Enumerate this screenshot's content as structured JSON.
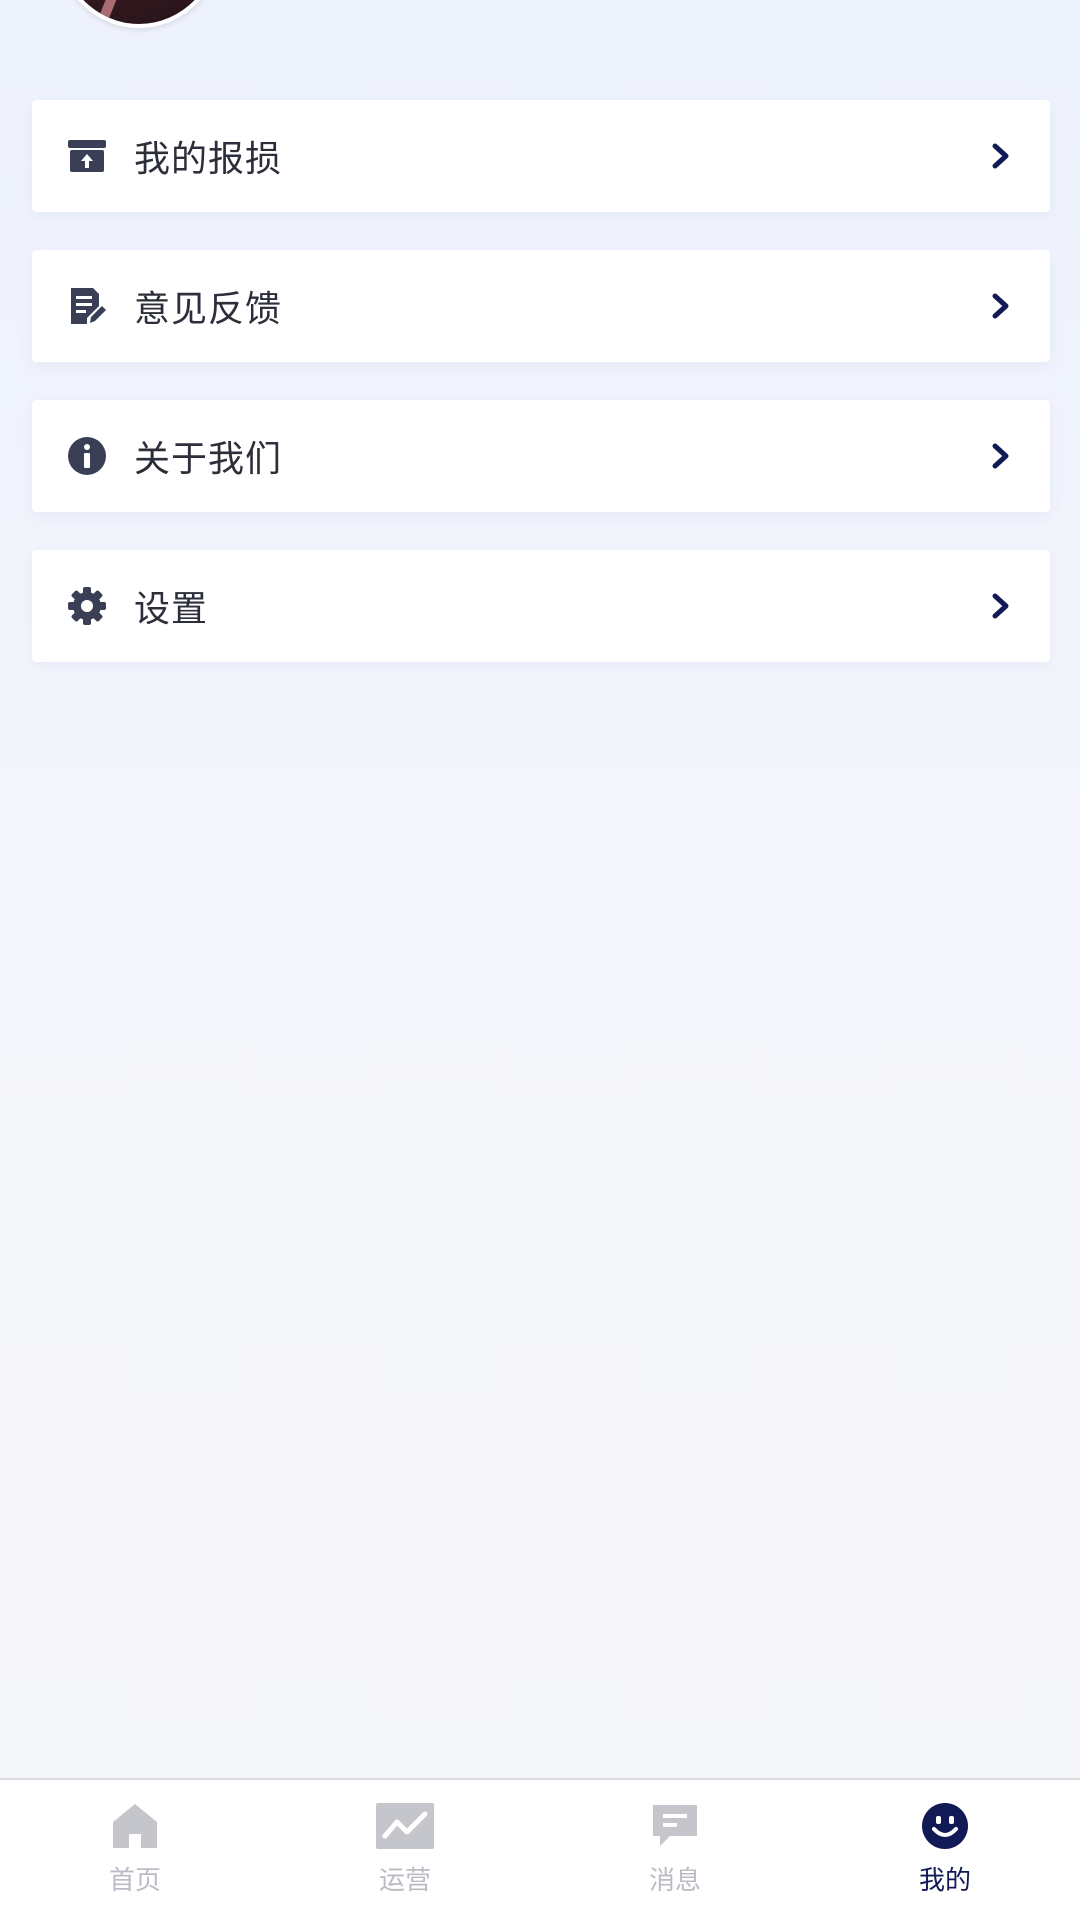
{
  "colors": {
    "accent": "#121a56",
    "icon_dark": "#3b3f55",
    "tab_inactive": "#c4c6cc"
  },
  "menu": {
    "items": [
      {
        "label": "我的报损",
        "icon": "box-upload-icon"
      },
      {
        "label": "意见反馈",
        "icon": "document-edit-icon"
      },
      {
        "label": "关于我们",
        "icon": "info-icon"
      },
      {
        "label": "设置",
        "icon": "gear-icon"
      }
    ]
  },
  "tabbar": {
    "tabs": [
      {
        "label": "首页",
        "icon": "home-icon",
        "active": false
      },
      {
        "label": "运营",
        "icon": "chart-icon",
        "active": false
      },
      {
        "label": "消息",
        "icon": "message-icon",
        "active": false
      },
      {
        "label": "我的",
        "icon": "smile-icon",
        "active": true
      }
    ]
  }
}
